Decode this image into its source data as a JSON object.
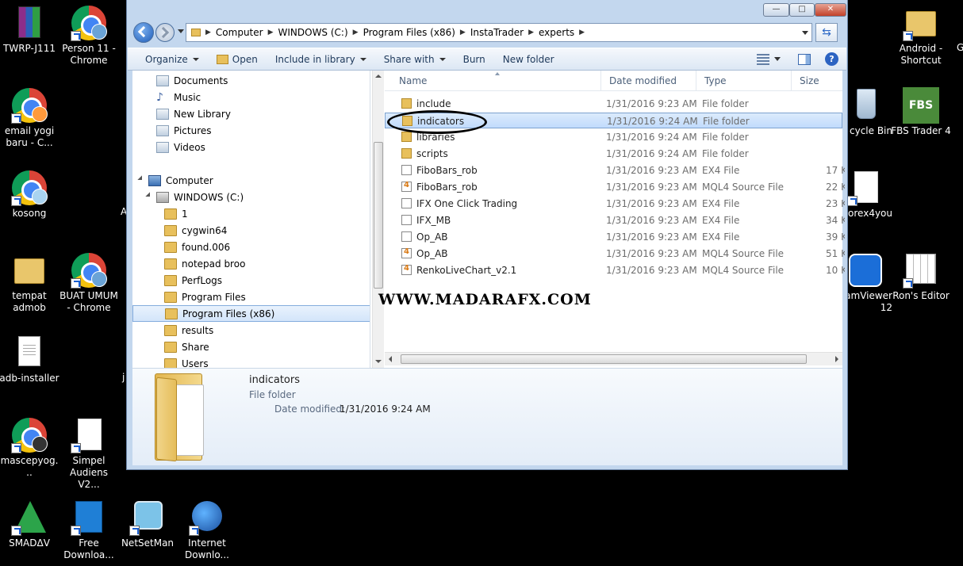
{
  "desktop": {
    "left_icons": [
      {
        "label": "TWRP-J111",
        "icon": "winrar-archive-icon"
      },
      {
        "label": "Person 11 - Chrome",
        "icon": "chrome-icon"
      },
      {
        "label": "email yogi baru - C...",
        "icon": "chrome-icon"
      },
      {
        "label": "kosong",
        "icon": "chrome-icon"
      },
      {
        "label": "tempat admob",
        "icon": "folder-icon"
      },
      {
        "label": "BUAT UMUM - Chrome",
        "icon": "chrome-icon"
      },
      {
        "label": "adb-installer",
        "icon": "text-document-icon"
      },
      {
        "label": "mascepyog...",
        "icon": "chrome-icon"
      },
      {
        "label": "Simpel Audiens V2...",
        "icon": "blank-document-icon"
      },
      {
        "label": "SMADΔV",
        "icon": "smadav-icon"
      },
      {
        "label": "Free Downloa...",
        "icon": "free-download-icon"
      },
      {
        "label": "NetSetMan",
        "icon": "netsetman-icon"
      },
      {
        "label": "Internet Downlo...",
        "icon": "idm-icon"
      }
    ],
    "right_icons": [
      {
        "label": "Android - Shortcut",
        "icon": "folder-shortcut-icon"
      },
      {
        "label": "cycle Bin",
        "icon": "recycle-bin-icon"
      },
      {
        "label": "FBS Trader 4",
        "icon": "fbs-trader-icon",
        "badge": "FBS"
      },
      {
        "label": "orex4you",
        "icon": "blank-document-icon"
      },
      {
        "label": "amViewer 12",
        "icon": "teamviewer-icon"
      },
      {
        "label": "Ron's Editor",
        "icon": "rons-editor-icon"
      }
    ],
    "fragments": {
      "g_fragment": "G",
      "a_fragment": "A",
      "j_fragment": "j"
    }
  },
  "window": {
    "controls": {
      "minimize": "—",
      "maximize": "□",
      "close": "✕"
    },
    "address": {
      "crumbs": [
        "Computer",
        "WINDOWS (C:)",
        "Program Files (x86)",
        "InstaTrader",
        "experts"
      ],
      "separator": "▶"
    },
    "toolbar": {
      "organize": "Organize",
      "open": "Open",
      "include_in_library": "Include in library",
      "share_with": "Share with",
      "burn": "Burn",
      "new_folder": "New folder"
    },
    "nav_tree": [
      {
        "label": "Documents",
        "icon": "library-icon"
      },
      {
        "label": "Music",
        "icon": "music-icon"
      },
      {
        "label": "New Library",
        "icon": "library-icon"
      },
      {
        "label": "Pictures",
        "icon": "library-icon"
      },
      {
        "label": "Videos",
        "icon": "library-icon"
      },
      {
        "label": "Computer",
        "icon": "computer-icon"
      },
      {
        "label": "WINDOWS (C:)",
        "icon": "drive-icon"
      },
      {
        "label": "1",
        "icon": "folder-icon"
      },
      {
        "label": "cygwin64",
        "icon": "folder-icon"
      },
      {
        "label": "found.006",
        "icon": "folder-icon"
      },
      {
        "label": "notepad broo",
        "icon": "folder-icon"
      },
      {
        "label": "PerfLogs",
        "icon": "folder-icon"
      },
      {
        "label": "Program Files",
        "icon": "folder-icon"
      },
      {
        "label": "Program Files (x86)",
        "icon": "folder-icon",
        "selected": true
      },
      {
        "label": "results",
        "icon": "folder-icon"
      },
      {
        "label": "Share",
        "icon": "folder-icon"
      },
      {
        "label": "Users",
        "icon": "folder-icon"
      }
    ],
    "columns": {
      "name": "Name",
      "date": "Date modified",
      "type": "Type",
      "size": "Size"
    },
    "files": [
      {
        "name": "include",
        "date": "1/31/2016 9:23 AM",
        "type": "File folder",
        "size": "",
        "kind": "folder"
      },
      {
        "name": "indicators",
        "date": "1/31/2016 9:24 AM",
        "type": "File folder",
        "size": "",
        "kind": "folder",
        "selected": true
      },
      {
        "name": "libraries",
        "date": "1/31/2016 9:24 AM",
        "type": "File folder",
        "size": "",
        "kind": "folder"
      },
      {
        "name": "scripts",
        "date": "1/31/2016 9:24 AM",
        "type": "File folder",
        "size": "",
        "kind": "folder"
      },
      {
        "name": "FiboBars_rob",
        "date": "1/31/2016 9:23 AM",
        "type": "EX4 File",
        "size": "17 K",
        "kind": "ex4"
      },
      {
        "name": "FiboBars_rob",
        "date": "1/31/2016 9:23 AM",
        "type": "MQL4 Source File",
        "size": "22 K",
        "kind": "mql"
      },
      {
        "name": "IFX One Click Trading",
        "date": "1/31/2016 9:23 AM",
        "type": "EX4 File",
        "size": "23 K",
        "kind": "ex4"
      },
      {
        "name": "IFX_MB",
        "date": "1/31/2016 9:23 AM",
        "type": "EX4 File",
        "size": "34 K",
        "kind": "ex4"
      },
      {
        "name": "Op_AB",
        "date": "1/31/2016 9:23 AM",
        "type": "EX4 File",
        "size": "39 K",
        "kind": "ex4"
      },
      {
        "name": "Op_AB",
        "date": "1/31/2016 9:23 AM",
        "type": "MQL4 Source File",
        "size": "51 K",
        "kind": "mql"
      },
      {
        "name": "RenkoLiveChart_v2.1",
        "date": "1/31/2016 9:23 AM",
        "type": "MQL4 Source File",
        "size": "10 K",
        "kind": "mql"
      }
    ],
    "watermark": "WWW.MADARAFX.COM",
    "details": {
      "name": "indicators",
      "type": "File folder",
      "date_label": "Date modified:",
      "date_value": "1/31/2016 9:24 AM"
    }
  }
}
